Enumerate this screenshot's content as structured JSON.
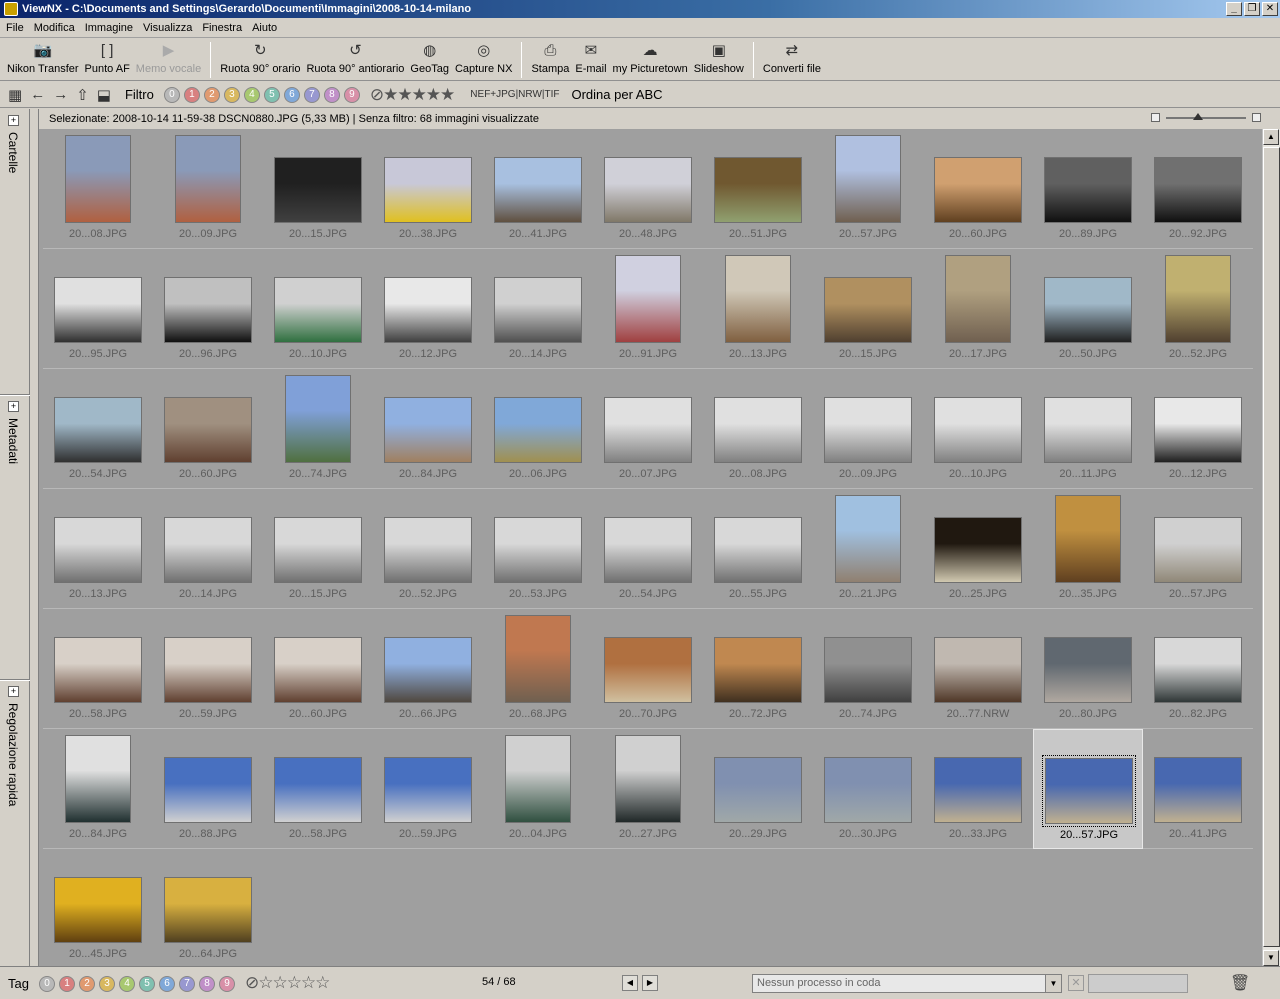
{
  "window": {
    "title": "ViewNX - C:\\Documents and Settings\\Gerardo\\Documenti\\Immagini\\2008-10-14-milano",
    "buttons": [
      "_",
      "❐",
      "✕"
    ]
  },
  "menu": [
    "File",
    "Modifica",
    "Immagine",
    "Visualizza",
    "Finestra",
    "Aiuto"
  ],
  "toolbar": [
    {
      "label": "Nikon Transfer",
      "icon": "camera-icon",
      "glyph": "📷"
    },
    {
      "label": "Punto AF",
      "icon": "af-point-icon",
      "glyph": "[ ]"
    },
    {
      "label": "Memo vocale",
      "icon": "voice-memo-icon",
      "glyph": "▶",
      "disabled": true
    },
    {
      "sep": true
    },
    {
      "label": "Ruota 90° orario",
      "icon": "rotate-cw-icon",
      "glyph": "↻"
    },
    {
      "label": "Ruota 90° antiorario",
      "icon": "rotate-ccw-icon",
      "glyph": "↺"
    },
    {
      "label": "GeoTag",
      "icon": "globe-icon",
      "glyph": "◍"
    },
    {
      "label": "Capture NX",
      "icon": "capture-nx-icon",
      "glyph": "◎"
    },
    {
      "sep": true
    },
    {
      "label": "Stampa",
      "icon": "printer-icon",
      "glyph": "⎙"
    },
    {
      "label": "E-mail",
      "icon": "mail-icon",
      "glyph": "✉"
    },
    {
      "label": "my Picturetown",
      "icon": "picturetown-icon",
      "glyph": "☁"
    },
    {
      "label": "Slideshow",
      "icon": "slideshow-icon",
      "glyph": "▣"
    },
    {
      "sep": true
    },
    {
      "label": "Converti file",
      "icon": "convert-icon",
      "glyph": "⇄"
    }
  ],
  "filterbar": {
    "filter_label": "Filtro",
    "labels": [
      {
        "n": "0",
        "color": "#b8b8b8"
      },
      {
        "n": "1",
        "color": "#d88080"
      },
      {
        "n": "2",
        "color": "#e09a70"
      },
      {
        "n": "3",
        "color": "#d8b860"
      },
      {
        "n": "4",
        "color": "#a8c870"
      },
      {
        "n": "5",
        "color": "#80c0b0"
      },
      {
        "n": "6",
        "color": "#80a8d8"
      },
      {
        "n": "7",
        "color": "#9898d0"
      },
      {
        "n": "8",
        "color": "#c090c8"
      },
      {
        "n": "9",
        "color": "#d890a8"
      }
    ],
    "format": "NEF+JPG|NRW|TIF",
    "sort": "Ordina per ABC"
  },
  "sidepanel": {
    "tabs": [
      "Cartelle",
      "Metadati",
      "Regolazione rapida"
    ]
  },
  "browser": {
    "info": "Selezionate: 2008-10-14 11-59-38 DSCN0880.JPG (5,33 MB) | Senza filtro: 68 immagini visualizzate",
    "selected_index": 64,
    "thumbnails": [
      {
        "name": "20...08.JPG",
        "orient": "p",
        "c": [
          "#8a9ab8",
          "#b06040"
        ]
      },
      {
        "name": "20...09.JPG",
        "orient": "p",
        "c": [
          "#8a9ab8",
          "#b06040"
        ]
      },
      {
        "name": "20...15.JPG",
        "orient": "l",
        "c": [
          "#202020",
          "#404040"
        ]
      },
      {
        "name": "20...38.JPG",
        "orient": "l",
        "c": [
          "#c8c8d8",
          "#e0c020"
        ]
      },
      {
        "name": "20...41.JPG",
        "orient": "l",
        "c": [
          "#a8c0e0",
          "#605040"
        ]
      },
      {
        "name": "20...48.JPG",
        "orient": "l",
        "c": [
          "#d0d0d8",
          "#807868"
        ]
      },
      {
        "name": "20...51.JPG",
        "orient": "l",
        "c": [
          "#705830",
          "#90a070"
        ]
      },
      {
        "name": "20...57.JPG",
        "orient": "p",
        "c": [
          "#b0c0e0",
          "#706050"
        ]
      },
      {
        "name": "20...60.JPG",
        "orient": "l",
        "c": [
          "#d0a070",
          "#604020"
        ]
      },
      {
        "name": "20...89.JPG",
        "orient": "l",
        "c": [
          "#606060",
          "#101010"
        ]
      },
      {
        "name": "20...92.JPG",
        "orient": "l",
        "c": [
          "#707070",
          "#101010"
        ]
      },
      {
        "name": "20...95.JPG",
        "orient": "l",
        "c": [
          "#e0e0e0",
          "#303030"
        ]
      },
      {
        "name": "20...96.JPG",
        "orient": "l",
        "c": [
          "#c0c0c0",
          "#101010"
        ]
      },
      {
        "name": "20...10.JPG",
        "orient": "l",
        "c": [
          "#d0d0d0",
          "#307040"
        ]
      },
      {
        "name": "20...12.JPG",
        "orient": "l",
        "c": [
          "#e8e8e8",
          "#404040"
        ]
      },
      {
        "name": "20...14.JPG",
        "orient": "l",
        "c": [
          "#d0d0d0",
          "#505050"
        ]
      },
      {
        "name": "20...91.JPG",
        "orient": "p",
        "c": [
          "#d0d0e0",
          "#a04040"
        ]
      },
      {
        "name": "20...13.JPG",
        "orient": "p",
        "c": [
          "#d0c8b8",
          "#806040"
        ]
      },
      {
        "name": "20...15.JPG",
        "orient": "l",
        "c": [
          "#b09060",
          "#504030"
        ]
      },
      {
        "name": "20...17.JPG",
        "orient": "p",
        "c": [
          "#b0a080",
          "#706050"
        ]
      },
      {
        "name": "20...50.JPG",
        "orient": "l",
        "c": [
          "#a0b8c8",
          "#202020"
        ]
      },
      {
        "name": "20...52.JPG",
        "orient": "p",
        "c": [
          "#c0b070",
          "#504030"
        ]
      },
      {
        "name": "20...54.JPG",
        "orient": "l",
        "c": [
          "#a0b8c8",
          "#303030"
        ]
      },
      {
        "name": "20...60.JPG",
        "orient": "l",
        "c": [
          "#a09080",
          "#604030"
        ]
      },
      {
        "name": "20...74.JPG",
        "orient": "p",
        "c": [
          "#80a0d8",
          "#507040"
        ]
      },
      {
        "name": "20...84.JPG",
        "orient": "l",
        "c": [
          "#90b0e0",
          "#a08060"
        ]
      },
      {
        "name": "20...06.JPG",
        "orient": "l",
        "c": [
          "#80a8d8",
          "#a09050"
        ]
      },
      {
        "name": "20...07.JPG",
        "orient": "l",
        "c": [
          "#e0e0e0",
          "#808080"
        ]
      },
      {
        "name": "20...08.JPG",
        "orient": "l",
        "c": [
          "#e0e0e0",
          "#808080"
        ]
      },
      {
        "name": "20...09.JPG",
        "orient": "l",
        "c": [
          "#e0e0e0",
          "#808080"
        ]
      },
      {
        "name": "20...10.JPG",
        "orient": "l",
        "c": [
          "#e0e0e0",
          "#808080"
        ]
      },
      {
        "name": "20...11.JPG",
        "orient": "l",
        "c": [
          "#e0e0e0",
          "#808080"
        ]
      },
      {
        "name": "20...12.JPG",
        "orient": "l",
        "c": [
          "#e8e8e8",
          "#202020"
        ]
      },
      {
        "name": "20...13.JPG",
        "orient": "l",
        "c": [
          "#d8d8d8",
          "#707070"
        ]
      },
      {
        "name": "20...14.JPG",
        "orient": "l",
        "c": [
          "#d8d8d8",
          "#707070"
        ]
      },
      {
        "name": "20...15.JPG",
        "orient": "l",
        "c": [
          "#d8d8d8",
          "#707070"
        ]
      },
      {
        "name": "20...52.JPG",
        "orient": "l",
        "c": [
          "#d8d8d8",
          "#707070"
        ]
      },
      {
        "name": "20...53.JPG",
        "orient": "l",
        "c": [
          "#d8d8d8",
          "#707070"
        ]
      },
      {
        "name": "20...54.JPG",
        "orient": "l",
        "c": [
          "#d8d8d8",
          "#707070"
        ]
      },
      {
        "name": "20...55.JPG",
        "orient": "l",
        "c": [
          "#d8d8d8",
          "#707070"
        ]
      },
      {
        "name": "20...21.JPG",
        "orient": "p",
        "c": [
          "#a0c0e0",
          "#908070"
        ]
      },
      {
        "name": "20...25.JPG",
        "orient": "l",
        "c": [
          "#201810",
          "#d0c8b0"
        ]
      },
      {
        "name": "20...35.JPG",
        "orient": "p",
        "c": [
          "#c09040",
          "#604020"
        ]
      },
      {
        "name": "20...57.JPG",
        "orient": "l",
        "c": [
          "#d0d0d0",
          "#908878"
        ]
      },
      {
        "name": "20...58.JPG",
        "orient": "l",
        "c": [
          "#d8d0c8",
          "#604030"
        ]
      },
      {
        "name": "20...59.JPG",
        "orient": "l",
        "c": [
          "#d8d0c8",
          "#604030"
        ]
      },
      {
        "name": "20...60.JPG",
        "orient": "l",
        "c": [
          "#d8d0c8",
          "#604030"
        ]
      },
      {
        "name": "20...66.JPG",
        "orient": "l",
        "c": [
          "#90b0e0",
          "#504840"
        ]
      },
      {
        "name": "20...68.JPG",
        "orient": "p",
        "c": [
          "#c07850",
          "#706050"
        ]
      },
      {
        "name": "20...70.JPG",
        "orient": "l",
        "c": [
          "#b07040",
          "#d0c0a0"
        ]
      },
      {
        "name": "20...72.JPG",
        "orient": "l",
        "c": [
          "#c08850",
          "#403020"
        ]
      },
      {
        "name": "20...74.JPG",
        "orient": "l",
        "c": [
          "#909090",
          "#404040"
        ]
      },
      {
        "name": "20...77.NRW",
        "orient": "l",
        "c": [
          "#c0b8b0",
          "#503828"
        ]
      },
      {
        "name": "20...80.JPG",
        "orient": "l",
        "c": [
          "#606870",
          "#b0a8a0"
        ]
      },
      {
        "name": "20...82.JPG",
        "orient": "l",
        "c": [
          "#d8d8d8",
          "#303838"
        ]
      },
      {
        "name": "20...84.JPG",
        "orient": "p",
        "c": [
          "#e0e0e0",
          "#203030"
        ]
      },
      {
        "name": "20...88.JPG",
        "orient": "l",
        "c": [
          "#4870c0",
          "#d0d0d0"
        ]
      },
      {
        "name": "20...58.JPG",
        "orient": "l",
        "c": [
          "#4870c0",
          "#d0d0d0"
        ]
      },
      {
        "name": "20...59.JPG",
        "orient": "l",
        "c": [
          "#4870c0",
          "#d0d0d0"
        ]
      },
      {
        "name": "20...04.JPG",
        "orient": "p",
        "c": [
          "#d0d0d0",
          "#305040"
        ]
      },
      {
        "name": "20...27.JPG",
        "orient": "p",
        "c": [
          "#d0d0d0",
          "#202828"
        ]
      },
      {
        "name": "20...29.JPG",
        "orient": "l",
        "c": [
          "#8090b0",
          "#a0a8a8"
        ]
      },
      {
        "name": "20...30.JPG",
        "orient": "l",
        "c": [
          "#8090b0",
          "#a0a8a8"
        ]
      },
      {
        "name": "20...33.JPG",
        "orient": "l",
        "c": [
          "#4868b0",
          "#c0b090"
        ]
      },
      {
        "name": "20...57.JPG",
        "orient": "l",
        "c": [
          "#4868b0",
          "#c0b090"
        ]
      },
      {
        "name": "20...41.JPG",
        "orient": "l",
        "c": [
          "#4868b0",
          "#c0b090"
        ]
      },
      {
        "name": "20...45.JPG",
        "orient": "l",
        "c": [
          "#e0b020",
          "#604010"
        ]
      },
      {
        "name": "20...64.JPG",
        "orient": "l",
        "c": [
          "#d8b040",
          "#504020"
        ]
      }
    ]
  },
  "status": {
    "tag_label": "Tag",
    "count": "54 / 68",
    "queue": "Nessun processo in coda"
  }
}
